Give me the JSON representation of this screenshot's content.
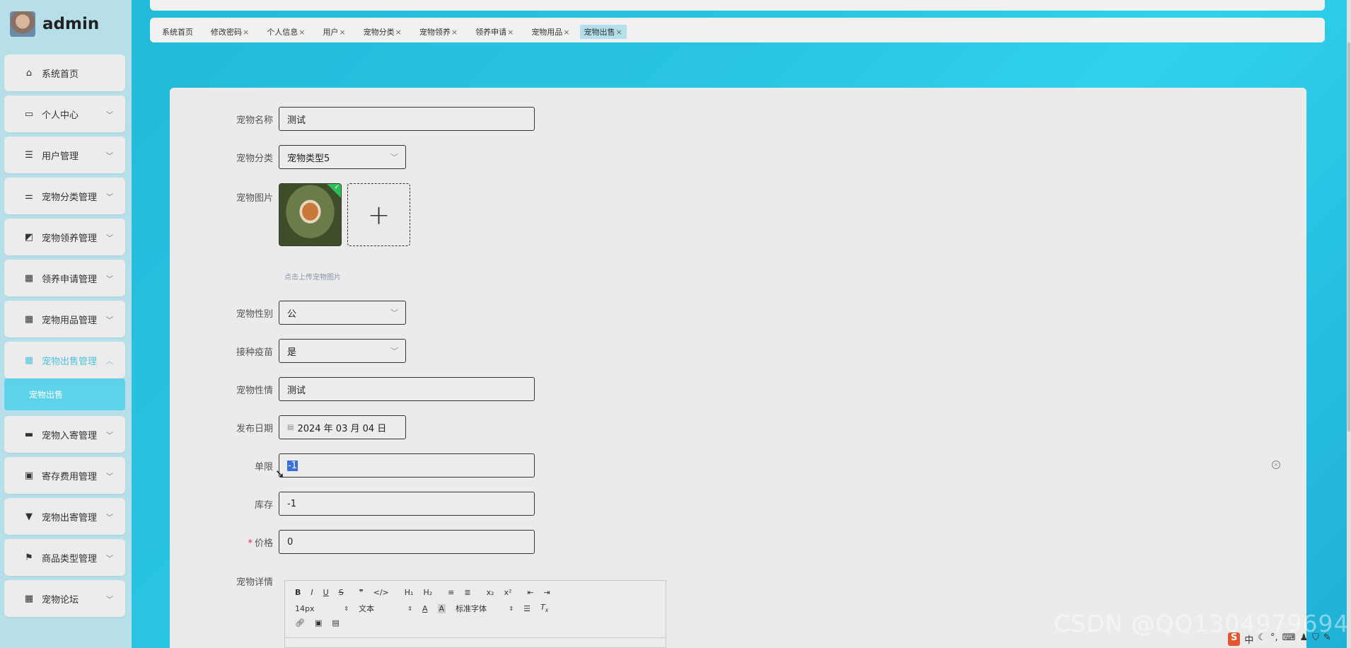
{
  "app": {
    "user_name": "admin"
  },
  "sidebar": {
    "items": [
      {
        "label": "系统首页",
        "icon": "home-icon"
      },
      {
        "label": "个人中心",
        "icon": "card-icon"
      },
      {
        "label": "用户管理",
        "icon": "list-icon"
      },
      {
        "label": "宠物分类管理",
        "icon": "sliders-icon"
      },
      {
        "label": "宠物领养管理",
        "icon": "chart-icon"
      },
      {
        "label": "领养申请管理",
        "icon": "grid-icon"
      },
      {
        "label": "宠物用品管理",
        "icon": "grid-icon"
      },
      {
        "label": "宠物出售管理",
        "icon": "grid-icon"
      },
      {
        "label": "宠物入寄管理",
        "icon": "chat-icon"
      },
      {
        "label": "寄存费用管理",
        "icon": "clipboard-icon"
      },
      {
        "label": "宠物出寄管理",
        "icon": "brush-icon"
      },
      {
        "label": "商品类型管理",
        "icon": "flag-icon"
      },
      {
        "label": "宠物论坛",
        "icon": "grid-icon"
      }
    ],
    "sub_item": "宠物出售"
  },
  "tabs": [
    "系统首页",
    "修改密码",
    "个人信息",
    "用户",
    "宠物分类",
    "宠物领养",
    "领养申请",
    "宠物用品",
    "宠物出售"
  ],
  "form": {
    "name_label": "宠物名称",
    "name_value": "测试",
    "category_label": "宠物分类",
    "category_value": "宠物类型5",
    "image_label": "宠物图片",
    "image_tip": "点击上传宠物图片",
    "gender_label": "宠物性别",
    "gender_value": "公",
    "vaccine_label": "接种疫苗",
    "vaccine_value": "是",
    "temper_label": "宠物性情",
    "temper_value": "测试",
    "date_label": "发布日期",
    "date_value": "2024 年 03 月 04 日",
    "limit_label": "单限",
    "limit_value": "-1",
    "stock_label": "库存",
    "stock_value": "-1",
    "price_label": "价格",
    "price_value": "0",
    "detail_label": "宠物详情"
  },
  "editor": {
    "font_size": "14px",
    "block_type": "文本",
    "font_family": "标准字体",
    "buttons_row1": [
      "B",
      "I",
      "U",
      "S",
      "❞",
      "</>",
      "H₁",
      "H₂",
      "≡",
      "≣",
      "x₂",
      "x²",
      "⇤",
      "⇥"
    ]
  },
  "watermark": "CSDN @QQ1304979694"
}
